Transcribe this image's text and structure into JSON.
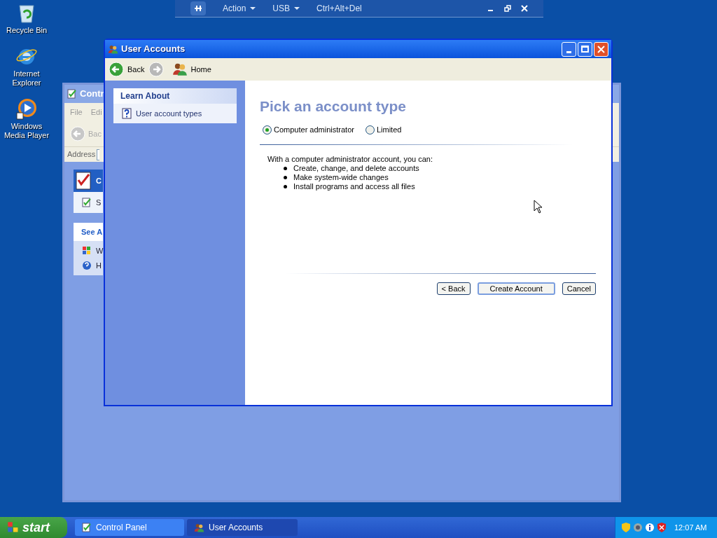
{
  "vm_toolbar": {
    "menus": [
      {
        "label": "Action"
      },
      {
        "label": "USB"
      }
    ],
    "command": "Ctrl+Alt+Del"
  },
  "desktop_icons": [
    {
      "label": "Recycle Bin",
      "kind": "recycle"
    },
    {
      "label": "Internet Explorer",
      "kind": "browser"
    },
    {
      "label": "Windows Media Player",
      "kind": "media"
    }
  ],
  "background_window": {
    "title": "Contr",
    "menu": [
      "File",
      "Edi"
    ],
    "back": "Bac",
    "address_label": "Address",
    "task_heading": "C",
    "task_item": "S",
    "see_also_heading": "See A",
    "see_also_items": [
      "W",
      "H"
    ]
  },
  "window": {
    "title": "User Accounts",
    "toolbar": {
      "back": "Back",
      "home": "Home"
    },
    "sidebar": {
      "heading": "Learn About",
      "items": [
        "User account types"
      ]
    },
    "heading": "Pick an account type",
    "options": [
      {
        "label": "Computer administrator",
        "selected": true
      },
      {
        "label": "Limited",
        "selected": false
      }
    ],
    "description": "With a computer administrator account, you can:",
    "bullets": [
      "Create, change, and delete accounts",
      "Make system-wide changes",
      "Install programs and access all files"
    ],
    "buttons": [
      {
        "label": "< Back",
        "default": false
      },
      {
        "label": "Create Account",
        "default": true
      },
      {
        "label": "Cancel",
        "default": false
      }
    ]
  },
  "taskbar": {
    "start": "start",
    "tasks": [
      {
        "label": "Control Panel",
        "selected": false
      },
      {
        "label": "User Accounts",
        "selected": true
      }
    ],
    "clock": "12:07 AM"
  }
}
